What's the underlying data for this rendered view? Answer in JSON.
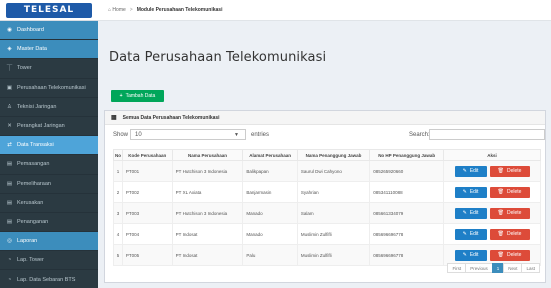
{
  "brand": {
    "logo_text": "TELESAL"
  },
  "sidebar": {
    "items": [
      {
        "label": "Dashboard",
        "icon": "dashboard-icon",
        "glyph": "◉",
        "state": "header"
      },
      {
        "label": "Master Data",
        "icon": "database-icon",
        "glyph": "◈",
        "state": "header"
      },
      {
        "label": "Tower",
        "icon": "tower-icon",
        "glyph": "⏉",
        "state": ""
      },
      {
        "label": "Perusahaan Telekomunikasi",
        "icon": "building-icon",
        "glyph": "▣",
        "state": ""
      },
      {
        "label": "Teknisi Jaringan",
        "icon": "user-icon",
        "glyph": "♙",
        "state": ""
      },
      {
        "label": "Perangkat Jaringan",
        "icon": "tools-icon",
        "glyph": "✕",
        "state": ""
      },
      {
        "label": "Data Transaksi",
        "icon": "transaction-icon",
        "glyph": "⇄",
        "state": "active"
      },
      {
        "label": "Pemasangan",
        "icon": "install-icon",
        "glyph": "▤",
        "state": ""
      },
      {
        "label": "Pemeliharaan",
        "icon": "maintenance-icon",
        "glyph": "▤",
        "state": ""
      },
      {
        "label": "Kerusakan",
        "icon": "damage-icon",
        "glyph": "▤",
        "state": ""
      },
      {
        "label": "Penanganan",
        "icon": "handling-icon",
        "glyph": "▤",
        "state": ""
      },
      {
        "label": "Laporan",
        "icon": "report-icon",
        "glyph": "◎",
        "state": "header"
      },
      {
        "label": "Lap. Tower",
        "icon": "report-file-icon",
        "glyph": "◔",
        "state": ""
      },
      {
        "label": "Lap. Data Sebaran BTS",
        "icon": "report-file-icon",
        "glyph": "◔",
        "state": ""
      }
    ]
  },
  "breadcrumb": {
    "home": "Home",
    "separator": ">",
    "current": "Module Perusahaan Telekomunikasi"
  },
  "page": {
    "title": "Data Perusahaan Telekomunikasi"
  },
  "actions": {
    "add_label": "Tambah Data",
    "add_icon": "+"
  },
  "panel": {
    "title": "Semua Data Perusahaan Telekomunikasi",
    "show_label": "Show",
    "entries_value": "10",
    "entries_label": "entries",
    "search_label": "Search:",
    "search_value": ""
  },
  "table": {
    "columns": [
      "No",
      "Kode Perusahaan",
      "Nama Perusahaan",
      "Alamat Perusahaan",
      "Nama Penanggung Jawab",
      "No HP Penanggung Jawab",
      "Aksi"
    ],
    "rows": [
      [
        "1",
        "PT001",
        "PT Hutchison 3 Indonesia",
        "Balikpapan",
        "Saurul Dwi Cahyono",
        "085265920660"
      ],
      [
        "2",
        "PT002",
        "PT XL Axiata",
        "Banjarmasin",
        "Syahrian",
        "085341110088"
      ],
      [
        "3",
        "PT003",
        "PT Hutchison 3 Indonesia",
        "Manado",
        "Salam",
        "085661334079"
      ],
      [
        "4",
        "PT004",
        "PT Indosat",
        "Manado",
        "Muslimin Zulfifli",
        "085696696778"
      ],
      [
        "5",
        "PT005",
        "PT Indosat",
        "Palu",
        "Muslimin Zulfifli",
        "085696696778"
      ]
    ],
    "edit_label": "Edit",
    "delete_label": "Delete"
  },
  "pagination": {
    "first": "First",
    "previous": "Previous",
    "current": "1",
    "next": "Next",
    "last": "Last"
  },
  "colors": {
    "sidebar": "#2b3a42",
    "active": "#4ea4d9",
    "header_item": "#3c8dbc",
    "add": "#00a65a",
    "edit": "#1e7fc7",
    "delete": "#dd4b39"
  }
}
